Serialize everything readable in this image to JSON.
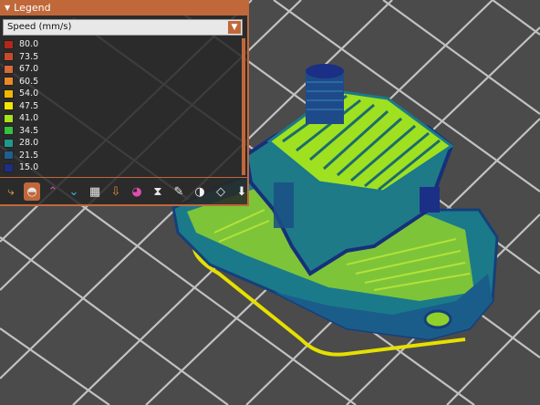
{
  "legend": {
    "title": "Legend",
    "view_type": "Speed (mm/s)",
    "ranges": [
      {
        "label": "80.0",
        "color": "#b3271a"
      },
      {
        "label": "73.5",
        "color": "#c9492b"
      },
      {
        "label": "67.0",
        "color": "#d9683a"
      },
      {
        "label": "60.5",
        "color": "#e98a25"
      },
      {
        "label": "54.0",
        "color": "#f0b800"
      },
      {
        "label": "47.5",
        "color": "#f4e600"
      },
      {
        "label": "41.0",
        "color": "#a7e21b"
      },
      {
        "label": "34.5",
        "color": "#35c33f"
      },
      {
        "label": "28.0",
        "color": "#1e9a8d"
      },
      {
        "label": "21.5",
        "color": "#1d5f92"
      },
      {
        "label": "15.0",
        "color": "#1b2f86"
      }
    ],
    "toolbar": [
      {
        "icon": "travel-icon"
      },
      {
        "icon": "wipe-icon"
      },
      {
        "icon": "retractions-icon"
      },
      {
        "icon": "deretractions-icon"
      },
      {
        "icon": "seams-icon"
      },
      {
        "icon": "tool-change-icon"
      },
      {
        "icon": "color-change-icon"
      },
      {
        "icon": "pause-icon"
      },
      {
        "icon": "custom-gcode-icon"
      },
      {
        "icon": "center-of-gravity-icon"
      },
      {
        "icon": "shells-icon"
      },
      {
        "icon": "tool-marker-icon"
      }
    ]
  },
  "colors": {
    "accent": "#c0683a",
    "background": "#4b4b4b",
    "grid_line": "#d8d8d8"
  }
}
